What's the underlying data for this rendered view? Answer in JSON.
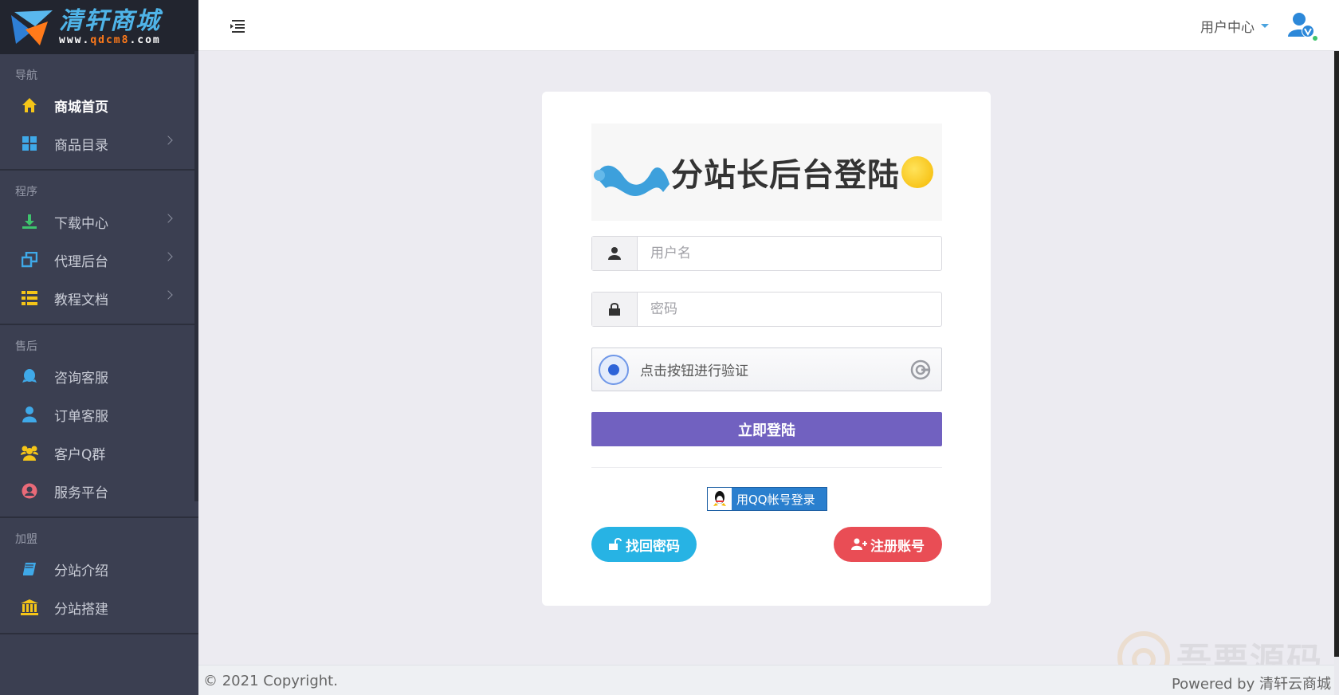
{
  "logo": {
    "title": "清轩商城",
    "url_prefix": "www.",
    "url_mid": "qdcm8",
    "url_suffix": ".com"
  },
  "sidebar": {
    "sections": [
      {
        "title": "导航",
        "items": [
          {
            "label": "商城首页",
            "icon": "home-icon",
            "color": "#f5c518",
            "active": true,
            "caret": false
          },
          {
            "label": "商品目录",
            "icon": "grid-icon",
            "color": "#3fa9e8",
            "caret": true
          }
        ]
      },
      {
        "title": "程序",
        "items": [
          {
            "label": "下载中心",
            "icon": "download-icon",
            "color": "#3ec46d",
            "caret": true
          },
          {
            "label": "代理后台",
            "icon": "windows-icon",
            "color": "#3fa9e8",
            "caret": true
          },
          {
            "label": "教程文档",
            "icon": "list-icon",
            "color": "#f5c518",
            "caret": true
          }
        ]
      },
      {
        "title": "售后",
        "items": [
          {
            "label": "咨询客服",
            "icon": "qq-icon",
            "color": "#3fa9e8"
          },
          {
            "label": "订单客服",
            "icon": "user-icon",
            "color": "#3fa9e8"
          },
          {
            "label": "客户Q群",
            "icon": "group-icon",
            "color": "#f5c518"
          },
          {
            "label": "服务平台",
            "icon": "user-circle-icon",
            "color": "#e96a78"
          }
        ]
      },
      {
        "title": "加盟",
        "items": [
          {
            "label": "分站介绍",
            "icon": "book-icon",
            "color": "#3fa9e8"
          },
          {
            "label": "分站搭建",
            "icon": "bank-icon",
            "color": "#f5c518"
          }
        ]
      }
    ]
  },
  "header": {
    "user_center": "用户中心"
  },
  "login": {
    "banner_title": "分站长后台登陆",
    "username_placeholder": "用户名",
    "password_placeholder": "密码",
    "verify_text": "点击按钮进行验证",
    "login_button": "立即登陆",
    "qq_login": "用QQ帐号登录",
    "forgot_password": "找回密码",
    "register": "注册账号"
  },
  "footer": {
    "copyright": "© 2021 Copyright.",
    "powered": "Powered by 清轩云商城"
  },
  "watermark": {
    "text": "吾要源码"
  },
  "colors": {
    "sidebar": "#3b3f51",
    "login_button": "#7161c0",
    "forgot": "#27b3e4",
    "register": "#e94d55",
    "qq": "#2a7fce"
  }
}
